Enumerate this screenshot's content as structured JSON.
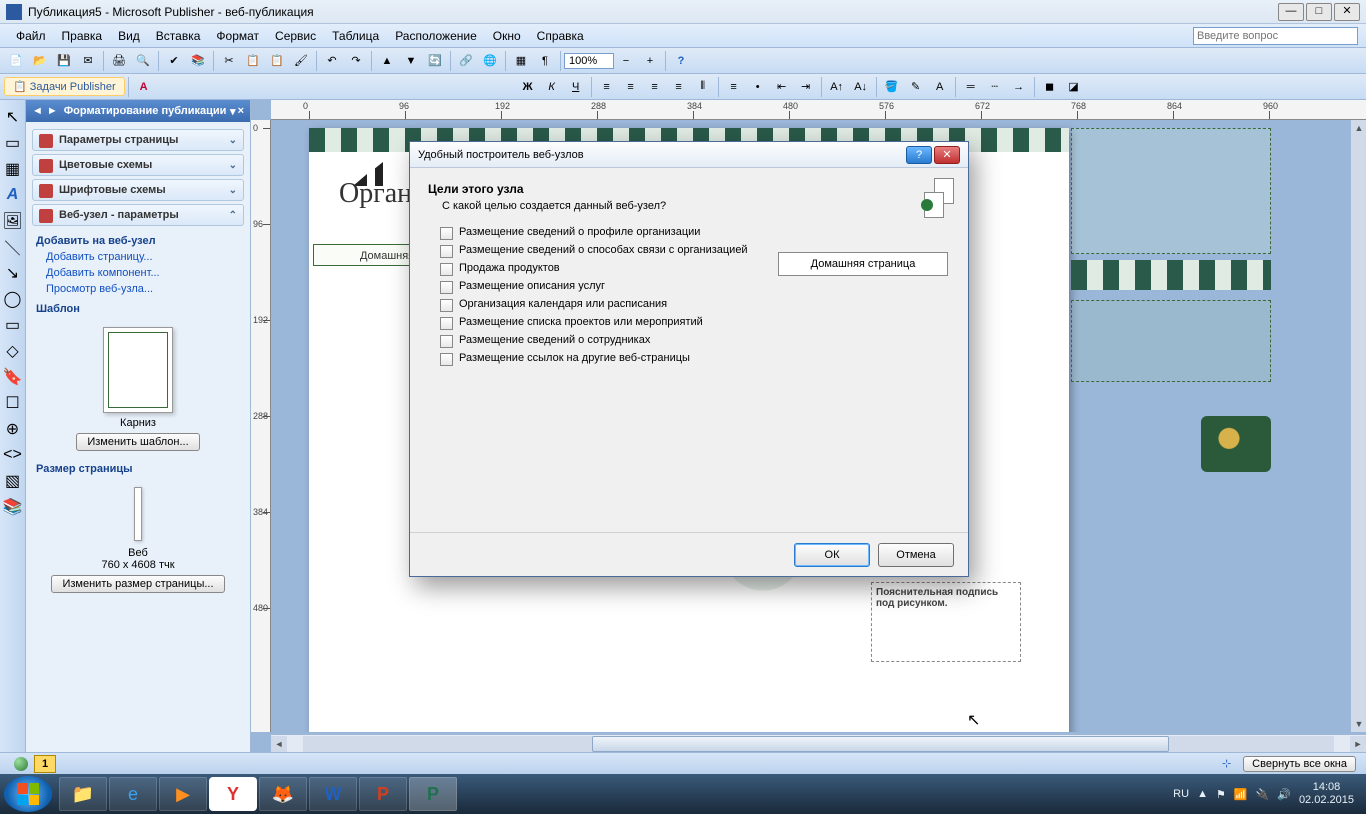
{
  "titlebar": {
    "text": "Публикация5 - Microsoft Publisher - веб-публикация"
  },
  "menus": [
    "Файл",
    "Правка",
    "Вид",
    "Вставка",
    "Формат",
    "Сервис",
    "Таблица",
    "Расположение",
    "Окно",
    "Справка"
  ],
  "question_placeholder": "Введите вопрос",
  "toolbar2": {
    "tasks_label": "Задачи Publisher",
    "zoom": "100%"
  },
  "taskpane": {
    "title": "Форматирование публикации",
    "sections": [
      "Параметры страницы",
      "Цветовые схемы",
      "Шрифтовые схемы",
      "Веб-узел - параметры"
    ],
    "add_header": "Добавить на веб-узел",
    "links": [
      "Добавить страницу...",
      "Добавить компонент...",
      "Просмотр веб-узла..."
    ],
    "template_header": "Шаблон",
    "template_name": "Карниз",
    "change_template": "Изменить шаблон...",
    "pagesize_header": "Размер страницы",
    "pagesize_name": "Веб",
    "pagesize_dim": "760 x 4608 тчк",
    "change_pagesize": "Изменить размер страницы..."
  },
  "ruler_h": [
    "0",
    "96",
    "192",
    "288",
    "384",
    "480",
    "576",
    "672",
    "768",
    "864",
    "960"
  ],
  "ruler_v": [
    "0",
    "96",
    "192",
    "288",
    "384",
    "480"
  ],
  "page": {
    "org_title": "Организа",
    "home_tab": "Домашняя стран",
    "caption": "Пояснительная подпись под рисунком."
  },
  "pagenav": {
    "page1": "1"
  },
  "statusbar": {
    "collapse": "Свернуть все окна"
  },
  "taskbar": {
    "lang": "RU",
    "time": "14:08",
    "date": "02.02.2015"
  },
  "dialog": {
    "title": "Удобный построитель веб-узлов",
    "heading": "Цели этого узла",
    "subtitle": "С какой целью создается данный веб-узел?",
    "checks": [
      "Размещение сведений о профиле организации",
      "Размещение сведений о способах связи с организацией",
      "Продажа продуктов",
      "Размещение описания услуг",
      "Организация календаря или расписания",
      "Размещение списка проектов или мероприятий",
      "Размещение сведений о сотрудниках",
      "Размещение ссылок на другие веб-страницы"
    ],
    "preview_label": "Домашняя страница",
    "ok": "ОК",
    "cancel": "Отмена"
  }
}
